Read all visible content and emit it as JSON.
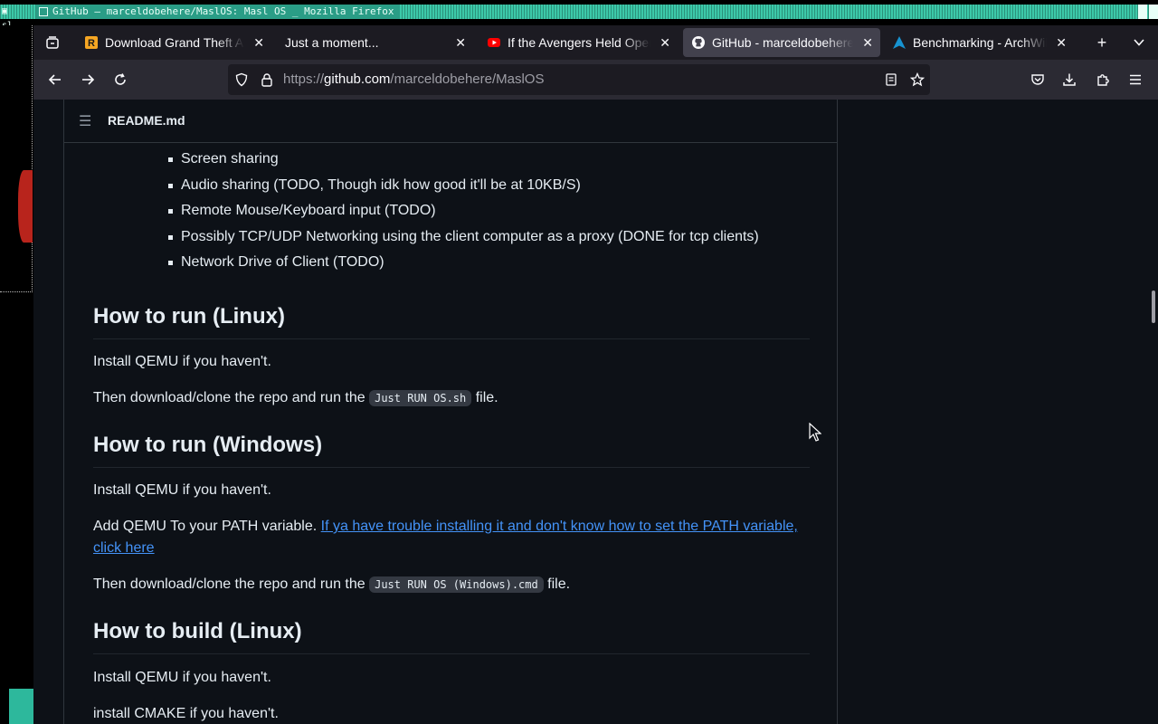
{
  "wm": {
    "icons": "▣ sl",
    "title": "GitHub – marceldobehere/MaslOS: Masl OS _ Mozilla Firefox"
  },
  "tabs": [
    {
      "label": "Download Grand Theft Auto",
      "favicon": "rockstar-icon",
      "active": false
    },
    {
      "label": "Just a moment...",
      "favicon": "none",
      "active": false
    },
    {
      "label": "If the Avengers Held Open",
      "favicon": "youtube-icon",
      "active": false
    },
    {
      "label": "GitHub - marceldobehere",
      "favicon": "github-icon",
      "active": true
    },
    {
      "label": "Benchmarking - ArchWiki",
      "favicon": "archlinux-icon",
      "active": false
    }
  ],
  "tab_close_glyph": "✕",
  "url": {
    "prefix": "https://",
    "host": "github.com",
    "path": "/marceldobehere/MaslOS"
  },
  "readme": {
    "filename": "README.md",
    "bullets": [
      "Screen sharing",
      "Audio sharing (TODO, Though idk how good it'll be at 10KB/S)",
      "Remote Mouse/Keyboard input (TODO)",
      "Possibly TCP/UDP Networking using the client computer as a proxy (DONE for tcp clients)",
      "Network Drive of Client (TODO)"
    ],
    "sections": {
      "linux_run": {
        "heading": "How to run (Linux)",
        "p1": "Install QEMU if you haven't.",
        "p2_before": "Then download/clone the repo and run the ",
        "p2_code": "Just RUN OS.sh",
        "p2_after": " file."
      },
      "windows_run": {
        "heading": "How to run (Windows)",
        "p1": "Install QEMU if you haven't.",
        "p2_before": "Add QEMU To your PATH variable. ",
        "p2_link1": "If ya have trouble installing it and don't know how to set the PATH variable,",
        "p2_link2": "click here",
        "p3_before": "Then download/clone the repo and run the ",
        "p3_code": "Just RUN OS (Windows).cmd",
        "p3_after": " file."
      },
      "linux_build": {
        "heading": "How to build (Linux)",
        "p1": "Install QEMU if you haven't.",
        "p2": "install CMAKE if you haven't."
      }
    }
  }
}
